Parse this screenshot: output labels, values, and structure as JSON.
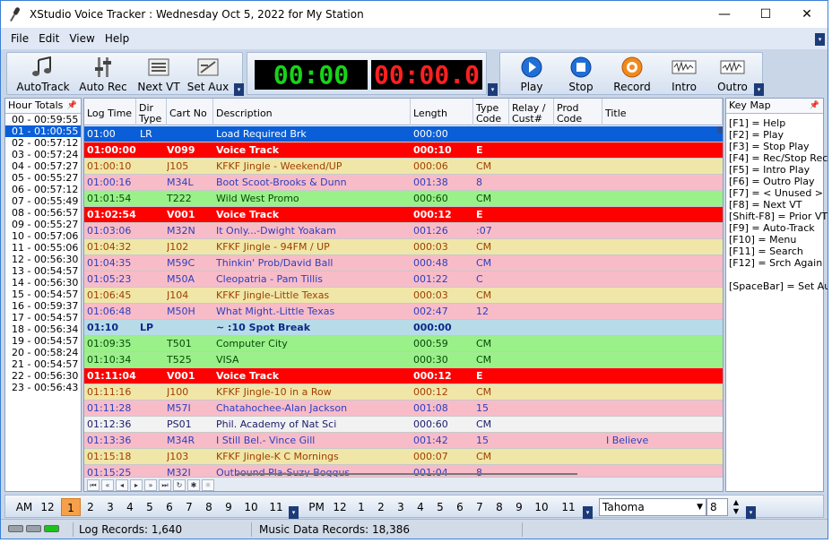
{
  "window": {
    "title": "XStudio Voice Tracker : Wednesday Oct 5, 2022 for My Station",
    "minimize": "—",
    "maximize": "☐",
    "close": "✕"
  },
  "menu": [
    "File",
    "Edit",
    "View",
    "Help"
  ],
  "toolbar_left": [
    "AutoTrack",
    "Auto Rec",
    "Next VT",
    "Set Aux"
  ],
  "clocks": {
    "elapsed": "00:00",
    "remaining": "00:00.0"
  },
  "toolbar_right": [
    "Play",
    "Stop",
    "Record",
    "Intro",
    "Outro"
  ],
  "hour_totals": {
    "title": "Hour Totals",
    "selected_index": 1,
    "items": [
      "00 - 00:59:55",
      "01 - 01:00:55",
      "02 - 00:57:12",
      "03 - 00:57:24",
      "04 - 00:57:27",
      "05 - 00:55:27",
      "06 - 00:57:12",
      "07 - 00:55:49",
      "08 - 00:56:57",
      "09 - 00:55:27",
      "10 - 00:57:06",
      "11 - 00:55:06",
      "12 - 00:56:30",
      "13 - 00:54:57",
      "14 - 00:56:30",
      "15 - 00:54:57",
      "16 - 00:59:37",
      "17 - 00:54:57",
      "18 - 00:56:34",
      "19 - 00:54:57",
      "20 - 00:58:24",
      "21 - 00:54:57",
      "22 - 00:56:30",
      "23 - 00:56:43"
    ]
  },
  "log": {
    "columns": [
      "Log Time",
      "Dir Type",
      "Cart No",
      "Description",
      "Length",
      "Type Code",
      "Relay / Cust#",
      "Prod Code",
      "Title"
    ],
    "rows": [
      {
        "time": "01:00",
        "dir": "LR",
        "cart": "",
        "desc": "Load Required Brk",
        "len": "000:00",
        "type": "",
        "title": "",
        "style": "sel"
      },
      {
        "time": "01:00:00",
        "dir": "",
        "cart": "V099",
        "desc": "Voice Track",
        "len": "000:10",
        "type": "E",
        "title": "",
        "style": "vt"
      },
      {
        "time": "01:00:10",
        "dir": "",
        "cart": "J105",
        "desc": "KFKF Jingle - Weekend/UP",
        "len": "000:06",
        "type": "CM",
        "title": "",
        "style": "jingle"
      },
      {
        "time": "01:00:16",
        "dir": "",
        "cart": "M34L",
        "desc": "Boot Scoot-Brooks & Dunn",
        "len": "001:38",
        "type": "8",
        "title": "",
        "style": "music"
      },
      {
        "time": "01:01:54",
        "dir": "",
        "cart": "T222",
        "desc": "Wild West Promo",
        "len": "000:60",
        "type": "CM",
        "title": "",
        "style": "promo"
      },
      {
        "time": "01:02:54",
        "dir": "",
        "cart": "V001",
        "desc": "Voice Track",
        "len": "000:12",
        "type": "E",
        "title": "",
        "style": "vt"
      },
      {
        "time": "01:03:06",
        "dir": "",
        "cart": "M32N",
        "desc": "It Only...-Dwight Yoakam",
        "len": "001:26",
        "type": ":07",
        "title": "",
        "style": "music"
      },
      {
        "time": "01:04:32",
        "dir": "",
        "cart": "J102",
        "desc": "KFKF Jingle - 94FM / UP",
        "len": "000:03",
        "type": "CM",
        "title": "",
        "style": "jingle"
      },
      {
        "time": "01:04:35",
        "dir": "",
        "cart": "M59C",
        "desc": "Thinkin' Prob/David Ball",
        "len": "000:48",
        "type": "CM",
        "title": "",
        "style": "music"
      },
      {
        "time": "01:05:23",
        "dir": "",
        "cart": "M50A",
        "desc": "Cleopatria - Pam Tillis",
        "len": "001:22",
        "type": "C",
        "title": "",
        "style": "music"
      },
      {
        "time": "01:06:45",
        "dir": "",
        "cart": "J104",
        "desc": "KFKF Jingle-Little Texas",
        "len": "000:03",
        "type": "CM",
        "title": "",
        "style": "jingle"
      },
      {
        "time": "01:06:48",
        "dir": "",
        "cart": "M50H",
        "desc": "What Might.-Little Texas",
        "len": "002:47",
        "type": "12",
        "title": "",
        "style": "music"
      },
      {
        "time": "01:10",
        "dir": "LP",
        "cart": "",
        "desc": "~ :10 Spot Break",
        "len": "000:00",
        "type": "",
        "title": "",
        "style": "break"
      },
      {
        "time": "01:09:35",
        "dir": "",
        "cart": "T501",
        "desc": "Computer City",
        "len": "000:59",
        "type": "CM",
        "title": "",
        "style": "promo"
      },
      {
        "time": "01:10:34",
        "dir": "",
        "cart": "T525",
        "desc": "VISA",
        "len": "000:30",
        "type": "CM",
        "title": "",
        "style": "promo"
      },
      {
        "time": "01:11:04",
        "dir": "",
        "cart": "V001",
        "desc": "Voice Track",
        "len": "000:12",
        "type": "E",
        "title": "",
        "style": "vt"
      },
      {
        "time": "01:11:16",
        "dir": "",
        "cart": "J100",
        "desc": "KFKF Jingle-10 in a Row",
        "len": "000:12",
        "type": "CM",
        "title": "",
        "style": "jingle"
      },
      {
        "time": "01:11:28",
        "dir": "",
        "cart": "M57I",
        "desc": "Chatahochee-Alan Jackson",
        "len": "001:08",
        "type": "15",
        "title": "",
        "style": "music"
      },
      {
        "time": "01:12:36",
        "dir": "",
        "cart": "PS01",
        "desc": "Phil. Academy of Nat Sci",
        "len": "000:60",
        "type": "CM",
        "title": "",
        "style": "psa"
      },
      {
        "time": "01:13:36",
        "dir": "",
        "cart": "M34R",
        "desc": "I Still Bel.- Vince Gill",
        "len": "001:42",
        "type": "15",
        "title": "I Believe",
        "style": "music"
      },
      {
        "time": "01:15:18",
        "dir": "",
        "cart": "J103",
        "desc": "KFKF Jingle-K C Mornings",
        "len": "000:07",
        "type": "CM",
        "title": "",
        "style": "jingle"
      },
      {
        "time": "01:15:25",
        "dir": "",
        "cart": "M32I",
        "desc": "Outbound Pla-Suzy Boggus",
        "len": "001:04",
        "type": "8",
        "title": "",
        "style": "music"
      }
    ]
  },
  "colors": {
    "vt": "#ff0000",
    "jingle": "#f0e6a8",
    "music": "#f8bcc8",
    "promo": "#9af089",
    "break": "#b8dbe8",
    "psa": "#f2f2f2",
    "sel": "#0a5fd8",
    "accent_orange": "#f7a04a"
  },
  "keymap": {
    "title": "Key Map",
    "items": [
      "[F1] = Help",
      "[F2] = Play",
      "[F3] = Stop Play",
      "[F4] = Rec/Stop Rec",
      "[F5] = Intro Play",
      "[F6] = Outro Play",
      "[F7] = < Unused >",
      "[F8] = Next VT",
      "[Shift-F8] = Prior VT",
      "[F9] = Auto-Track",
      "[F10] = Menu",
      "[F11] = Search",
      "[F12] = Srch Again",
      "",
      "[SpaceBar] = Set Aux"
    ]
  },
  "hourbar": {
    "am_label": "AM",
    "pm_label": "PM",
    "am_hours": [
      "12",
      "1",
      "2",
      "3",
      "4",
      "5",
      "6",
      "7",
      "8",
      "9",
      "10",
      "11"
    ],
    "pm_hours": [
      "12",
      "1",
      "2",
      "3",
      "4",
      "5",
      "6",
      "7",
      "8",
      "9",
      "10",
      "11"
    ],
    "active_am_index": 1,
    "font_name": "Tahoma",
    "font_size": "8"
  },
  "status": {
    "log_records": "Log Records: 1,640",
    "music_records": "Music Data Records: 18,386"
  }
}
